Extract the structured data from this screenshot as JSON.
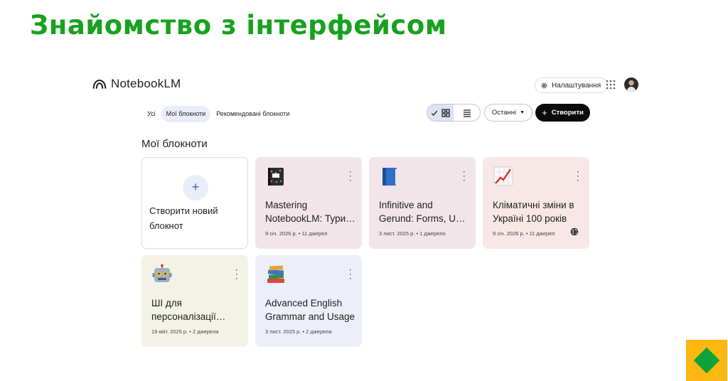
{
  "slide": {
    "title": "Знайомство з інтерфейсом"
  },
  "app": {
    "logo_text": "NotebookLM",
    "settings_label": "Налаштування",
    "filters": [
      {
        "label": "Усі",
        "active": false
      },
      {
        "label": "Мої блокноти",
        "active": true
      },
      {
        "label": "Рекомендовані блокноти",
        "active": false
      }
    ],
    "sort_label": "Останні",
    "create_label": "Створити",
    "section_title": "Мої блокноти",
    "new_notebook_label": "Створити новий блокнот",
    "notebooks": [
      {
        "icon": "notebook-emoji-icon",
        "title": "Mastering NotebookLM: Тури та Хитрощі",
        "meta": "9 січ. 2026 р. • 11 джерел",
        "color": "#f1e5ea",
        "public": false
      },
      {
        "icon": "blue-book-emoji-icon",
        "title": "Infinitive and Gerund: Forms, Use and Practice",
        "meta": "3 лист. 2025 р. • 1 джерело",
        "color": "#f1e5ea",
        "public": false
      },
      {
        "icon": "chart-increasing-emoji-icon",
        "title": "Кліматичні зміни в Україні 100 років",
        "meta": "9 січ. 2026 р. • 11 джерел",
        "color": "#f7e7e6",
        "public": true
      },
      {
        "icon": "robot-emoji-icon",
        "title": "ШІ для персоналізації навчання",
        "meta": "19 квіт. 2025 р. • 2 джерела",
        "color": "#f2f2e7",
        "public": false
      },
      {
        "icon": "books-emoji-icon",
        "title": "Advanced English Grammar and Usage",
        "meta": "3 лист. 2025 р. • 2 джерела",
        "color": "#eceff9",
        "public": false
      }
    ]
  },
  "colors": {
    "title_green": "#17a11f",
    "badge_yellow": "#fcb713",
    "badge_green": "#10a23a"
  }
}
